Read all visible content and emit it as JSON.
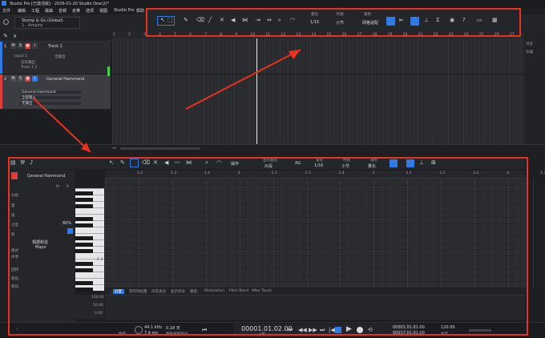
{
  "window": {
    "title": "Studio Pro [已激活版] - 2026-01-20 Studio One(2)*"
  },
  "menubar": [
    "文件",
    "编辑",
    "工程",
    "歌曲",
    "音频",
    "走带",
    "选项",
    "视图",
    "Studio Pro",
    "帮助"
  ],
  "instrument_selector": {
    "name": "Stomp & Go (Global)",
    "preset": "1 - Ampire"
  },
  "toolbar": {
    "quantize_label": "量化",
    "quantize_value": "1/16",
    "timebase_label": "时基",
    "timebase_value": "小节",
    "snap_label": "吸附",
    "snap_value": "网格适配"
  },
  "top_ruler": [
    "1",
    "2",
    "3",
    "4",
    "5",
    "6",
    "7",
    "8",
    "9",
    "10",
    "11",
    "12",
    "13",
    "14",
    "15",
    "16",
    "17",
    "18",
    "19",
    "20",
    "21",
    "22",
    "23",
    "24",
    "25",
    "26",
    "27"
  ],
  "tracks": [
    {
      "number": "1",
      "name": "Track 1",
      "input": "Input 1",
      "output_label": "无输出",
      "monitor": "没有输出",
      "sub": "Track 1.1"
    },
    {
      "number": "2",
      "name": "General Hammond",
      "inst": "General Hammond",
      "in2": "全部输入",
      "out2": "无输出"
    }
  ],
  "track_buttons": {
    "m": "M",
    "s": "S",
    "r": "●",
    "i": "I"
  },
  "right_panel": {
    "tab": "浏览",
    "item": "乐器"
  },
  "editor": {
    "track_name": "General Hammond",
    "ruler": [
      "1.2",
      "1.3",
      "1.4",
      "2",
      "2.2",
      "2.3",
      "2.4",
      "3",
      "3.2",
      "3.3",
      "3.4",
      "4",
      "4.2"
    ],
    "toolbar_labels": {
      "action": "操作",
      "quantize_mode_label": "显示量化",
      "quantize_mode": "片段",
      "ag": "AG",
      "quantize_label": "量化",
      "quantize_value": "1/16",
      "timebase_label": "时基",
      "timebase_value": "小节",
      "snap_label": "吸附",
      "snap_value": "量化"
    },
    "inspector": {
      "rows": [
        "分组",
        "量",
        "值",
        "力度",
        "移",
        "",
        "",
        "模式",
        "",
        "声明",
        "回转",
        "和弦",
        "和弦"
      ],
      "pct": "80%",
      "chord_label": "根据和弦",
      "scale": "Major",
      "c2_label": "C 2"
    },
    "velocity_values": [
      "100.00",
      "50.00",
      "0.00"
    ],
    "cc_tabs": [
      "力度",
      "音符持续量",
      "声音表达",
      "显示符号",
      "最后",
      "Modulation",
      "Pitch Bend",
      "After Touch"
    ]
  },
  "transport": {
    "sample_rate": "44.1 kHz",
    "latency": "7.4 ms",
    "days": "0.18 天",
    "disk": "剩余录制时间",
    "position": "00001.01.02.00",
    "position_unit": "小节",
    "loop_start": "00001.01.01.00",
    "loop_end": "00017.01.01.00",
    "tempo": "120.00",
    "tempo_label": "速度",
    "performance": "性能"
  },
  "colors": {
    "accent": "#2f7ae5",
    "record": "#e23b3b",
    "annotation": "#e8321e",
    "bg": "#1c1d20"
  }
}
